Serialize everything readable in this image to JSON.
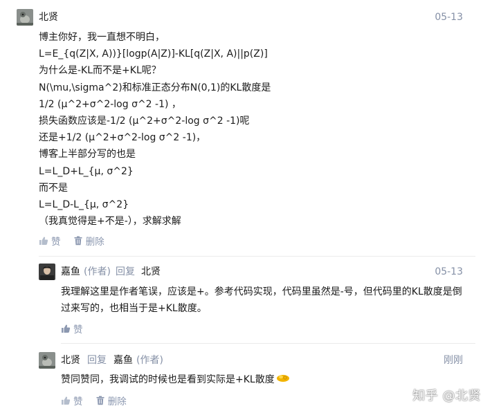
{
  "comments": [
    {
      "author": "北贤",
      "date": "05-13",
      "lines": [
        "博主你好，我一直想不明白，",
        "L=E_{q(Z|X, A))}[logp(A|Z)]-KL[q(Z|X, A)||p(Z)]",
        "为什么是-KL而不是+KL呢？",
        "N(\\mu,\\sigma^2)和标准正态分布N(0,1)的KL散度是",
        "1/2 (μ^2+σ^2-log σ^2 -1) ，",
        "损失函数应该是-1/2 (μ^2+σ^2-log σ^2 -1)呢",
        "还是+1/2 (μ^2+σ^2-log σ^2 -1)，",
        "博客上半部分写的也是",
        "L=L_D+L_{μ, σ^2}",
        "而不是",
        "L=L_D-L_{μ, σ^2}",
        "（我真觉得是+不是-），求解求解"
      ],
      "like_label": "赞",
      "delete_label": "删除"
    },
    {
      "author": "嘉鱼",
      "author_tag": "(作者)",
      "reply_label": "回复",
      "reply_to": "北贤",
      "date": "05-13",
      "text": "我理解这里是作者笔误，应该是+。参考代码实现，代码里虽然是-号，但代码里的KL散度是倒过来写的，也相当于是+KL散度。",
      "like_label": "赞"
    },
    {
      "author": "北贤",
      "reply_label": "回复",
      "reply_to": "嘉鱼",
      "reply_to_tag": "(作者)",
      "date": "刚刚",
      "text": "赞同赞同，我调试的时候也是看到实际是+KL散度",
      "emoji": "ok-hand-emoji",
      "like_label": "赞",
      "delete_label": "删除"
    }
  ],
  "watermark": "知乎 @北贤",
  "colors": {
    "meta": "#8590a6",
    "action": "#8c98b0",
    "text": "#1a1a1a",
    "divider": "#ebebeb"
  }
}
